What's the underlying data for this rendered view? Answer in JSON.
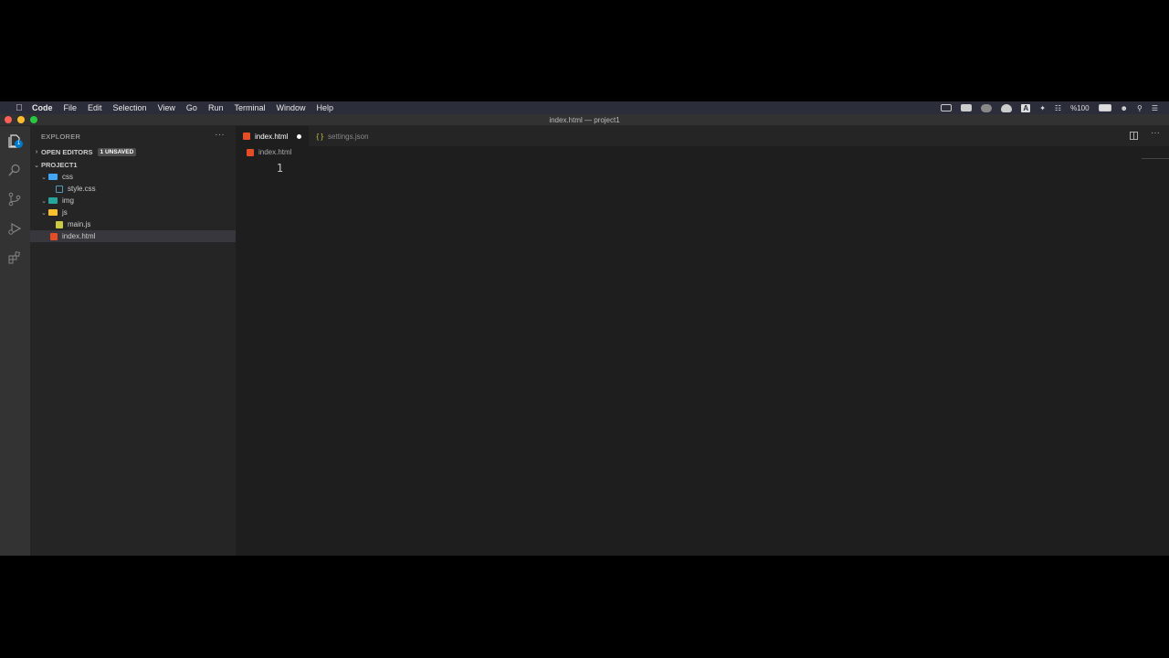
{
  "menubar": {
    "items": [
      "Code",
      "File",
      "Edit",
      "Selection",
      "View",
      "Go",
      "Run",
      "Terminal",
      "Window",
      "Help"
    ],
    "battery": "%100",
    "tray_letter": "A"
  },
  "window": {
    "title": "index.html — project1"
  },
  "activity": {
    "badge": "1"
  },
  "sidebar": {
    "title": "EXPLORER",
    "more": "···",
    "open_editors": {
      "label": "OPEN EDITORS",
      "badge": "1 UNSAVED"
    },
    "project": "PROJECT1",
    "tree": [
      {
        "name": "css",
        "type": "folder"
      },
      {
        "name": "style.css",
        "type": "file"
      },
      {
        "name": "img",
        "type": "folder"
      },
      {
        "name": "js",
        "type": "folder"
      },
      {
        "name": "main.js",
        "type": "file"
      },
      {
        "name": "index.html",
        "type": "file"
      }
    ]
  },
  "tabs": [
    {
      "label": "index.html",
      "active": true
    },
    {
      "label": "settings.json",
      "icon": "{ }",
      "active": false
    }
  ],
  "breadcrumb": {
    "file": "index.html"
  },
  "editor": {
    "line_numbers": [
      "1"
    ]
  },
  "colors": {
    "html_icon": "#e44d26",
    "css_icon": "#519aba",
    "js_icon": "#cbcb41",
    "folder_css": "#42a5f5",
    "folder_img": "#26a69a",
    "folder_js": "#fbc02d",
    "json_icon": "#cbcb41"
  }
}
